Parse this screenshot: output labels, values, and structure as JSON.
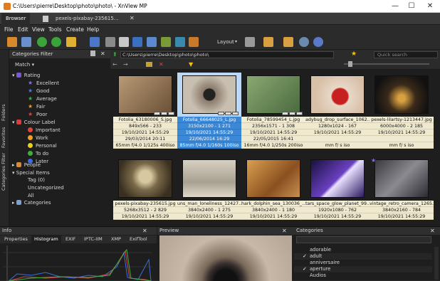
{
  "window": {
    "title": "C:\\Users\\pierre\\Desktop\\photo\\photo\\ - XnView MP",
    "minimize": "—",
    "maximize": "☐",
    "close": "✕"
  },
  "tabs": [
    {
      "label": "Browser"
    },
    {
      "label": "pexels-pixabay-235615..."
    }
  ],
  "menu": [
    "File",
    "Edit",
    "View",
    "Tools",
    "Create",
    "Help"
  ],
  "toolbar": {
    "layout_label": "Layout"
  },
  "side_tabs": [
    "Folders",
    "Favorites",
    "Categories Filter"
  ],
  "filter": {
    "title": "Categories Filter",
    "match_label": "Match",
    "rating_label": "Rating",
    "ratings": [
      "Excellent",
      "Good",
      "Average",
      "Fair",
      "Poor"
    ],
    "colour_label": "Colour Label",
    "colours": [
      {
        "name": "Important",
        "color": "#e0453a"
      },
      {
        "name": "Work",
        "color": "#f0a020"
      },
      {
        "name": "Personal",
        "color": "#e8d020"
      },
      {
        "name": "To do",
        "color": "#3aaf3a"
      },
      {
        "name": "Later",
        "color": "#3a6ee0"
      }
    ],
    "people_label": "People",
    "special_label": "Special Items",
    "special_items": [
      "Tag (0)",
      "Uncategorized",
      "All"
    ],
    "categories_label": "Categories"
  },
  "browser": {
    "path": "C:\\Users\\pierre\\Desktop\\photo\\photo\\",
    "search_placeholder": "Quick search"
  },
  "thumbnails": [
    {
      "name": "Fotolia_63180006_S.jpg",
      "dims": "849x566 - 233",
      "date": "19/10/2021 14:55:29",
      "date2": "29/03/2014 20:11",
      "exif": "65mm f/4.0 1/125s 400iso",
      "selected": false
    },
    {
      "name": "Fotolia_66648025_L.jpg",
      "dims": "3150x2100 - 1 271",
      "date": "19/10/2021 14:55:29",
      "date2": "22/06/2014 16:29",
      "exif": "85mm f/4.0 1/160s 100iso",
      "selected": true
    },
    {
      "name": "Fotolia_78599454_L.jpg",
      "dims": "2356x1571 - 1 308",
      "date": "19/10/2021 14:55:29",
      "date2": "22/05/2015 16:41",
      "exif": "16mm f/4.0 1/250s 200iso",
      "selected": false
    },
    {
      "name": "adybug_drop_surface_1062...",
      "dims": "1280x1024 - 167",
      "date": "19/10/2021 14:55:29",
      "date2": "",
      "exif": "mm f/ s iso",
      "selected": false
    },
    {
      "name": "pexels-lilartsy-1213447.jpg",
      "dims": "6000x4000 - 2 185",
      "date": "19/10/2021 14:55:29",
      "date2": "",
      "exif": "mm f/ s iso",
      "selected": false
    },
    {
      "name": "pexels-pixabay-235615.jpg",
      "dims": "5268x3512 - 2 829",
      "date": "19/10/2021 14:55:29",
      "date2": "",
      "exif": "",
      "selected": false
    },
    {
      "name": "uns_man_loneliness_12427...",
      "dims": "3840x2400 - 1 275",
      "date": "19/10/2021 14:55:29",
      "date2": "",
      "exif": "",
      "selected": false
    },
    {
      "name": "hark_dolphin_sea_130036_...",
      "dims": "3840x2400 - 1 180",
      "date": "19/10/2021 14:55:29",
      "date2": "",
      "exif": "",
      "selected": false
    },
    {
      "name": "tars_space_glow_planet_99...",
      "dims": "1920x1080 - 762",
      "date": "19/10/2021 14:55:29",
      "date2": "",
      "exif": "",
      "selected": false
    },
    {
      "name": "vintage_retro_camera_1265...",
      "dims": "3840x2160 - 784",
      "date": "19/10/2021 14:55:29",
      "date2": "",
      "exif": "",
      "selected": false
    }
  ],
  "info_panel": {
    "title": "Info",
    "tabs": [
      "Properties",
      "Histogram",
      "EXIF",
      "IPTC-IIM",
      "XMP",
      "ExifTool"
    ]
  },
  "preview_panel": {
    "title": "Preview"
  },
  "categories_panel": {
    "title": "Categories",
    "items": [
      {
        "label": "adorable",
        "checked": false
      },
      {
        "label": "adult",
        "checked": true
      },
      {
        "label": "anniversaire",
        "checked": false
      },
      {
        "label": "aperture",
        "checked": true
      },
      {
        "label": "Audios",
        "checked": false
      }
    ]
  }
}
